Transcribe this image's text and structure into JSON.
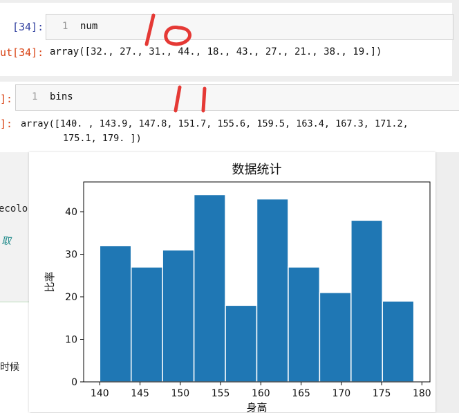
{
  "cells": [
    {
      "in_prompt": "[34]:",
      "line_number": "1",
      "code": "num",
      "out_prompt": "ut[34]:",
      "output": "array([32., 27., 31., 44., 18., 43., 27., 21., 38., 19.])"
    },
    {
      "in_prompt": "]:",
      "line_number": "1",
      "code": "bins",
      "out_prompt": "]:",
      "output_line1": "array([140. , 143.9, 147.8, 151.7, 155.6, 159.5, 163.4, 167.3, 171.2,",
      "output_line2": "175.1, 179. ])"
    }
  ],
  "top_partial_text": "~~~ ~ ~~~~~~~ ~~~",
  "side_fragments": {
    "color_fragment": "ecolor",
    "link_fragment": "取",
    "bottom_fragment": "时候"
  },
  "annotations": {
    "first": "10",
    "second": "11",
    "color": "#e53935"
  },
  "chart_data": {
    "type": "bar",
    "title": "数据统计",
    "xlabel": "身高",
    "ylabel": "比率",
    "bin_edges": [
      140.0,
      143.9,
      147.8,
      151.7,
      155.6,
      159.5,
      163.4,
      167.3,
      171.2,
      175.1,
      179.0
    ],
    "values": [
      32,
      27,
      31,
      44,
      18,
      43,
      27,
      21,
      38,
      19
    ],
    "xlim": [
      138,
      181
    ],
    "ylim": [
      0,
      47
    ],
    "xticks": [
      140,
      145,
      150,
      155,
      160,
      165,
      170,
      175,
      180
    ],
    "yticks": [
      0,
      10,
      20,
      30,
      40
    ],
    "bar_color": "#1f77b4",
    "edge_color": "#ffffff"
  }
}
